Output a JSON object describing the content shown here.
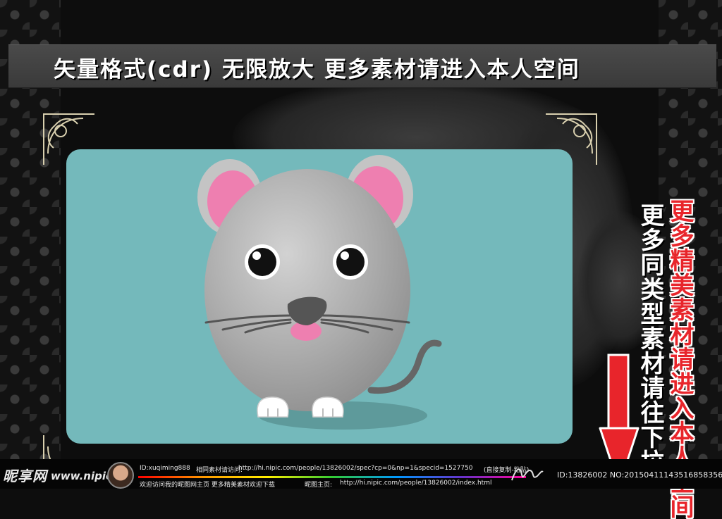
{
  "banner": {
    "text": "矢量格式(cdr) 无限放大   更多素材请进入本人空间"
  },
  "sidebar": {
    "red_text": "更多精美素材请进入本人空间",
    "white_text": "更多同类型素材请往下拉"
  },
  "footer": {
    "logo_text": "昵享网",
    "logo_url": "www.nipic.cn",
    "id_label": "ID:xuqiming888",
    "visit_label": "相同素材请访问:",
    "visit_url": "http://hi.nipic.com/people/13826002/spec?cp=0&np=1&specid=1527750",
    "copy_hint": "(直接复制-粘贴)",
    "welcome": "欢迎访问我的昵图网主页 更多精美素材欢迎下载",
    "home_label": "昵图主页:",
    "home_url": "http://hi.nipic.com/people/13826002/index.html",
    "image_id": "ID:13826002 NO:20150411143516858356"
  },
  "colors": {
    "card": "#74b9bb",
    "mouse_body": "#a9a9a9",
    "ear_pink": "#ee7fb0",
    "red_text": "#e8252b",
    "arrow_red": "#e8252b"
  },
  "icons": [
    "mouse-illustration",
    "corner-ornament",
    "down-arrow-icon",
    "avatar",
    "signature"
  ]
}
